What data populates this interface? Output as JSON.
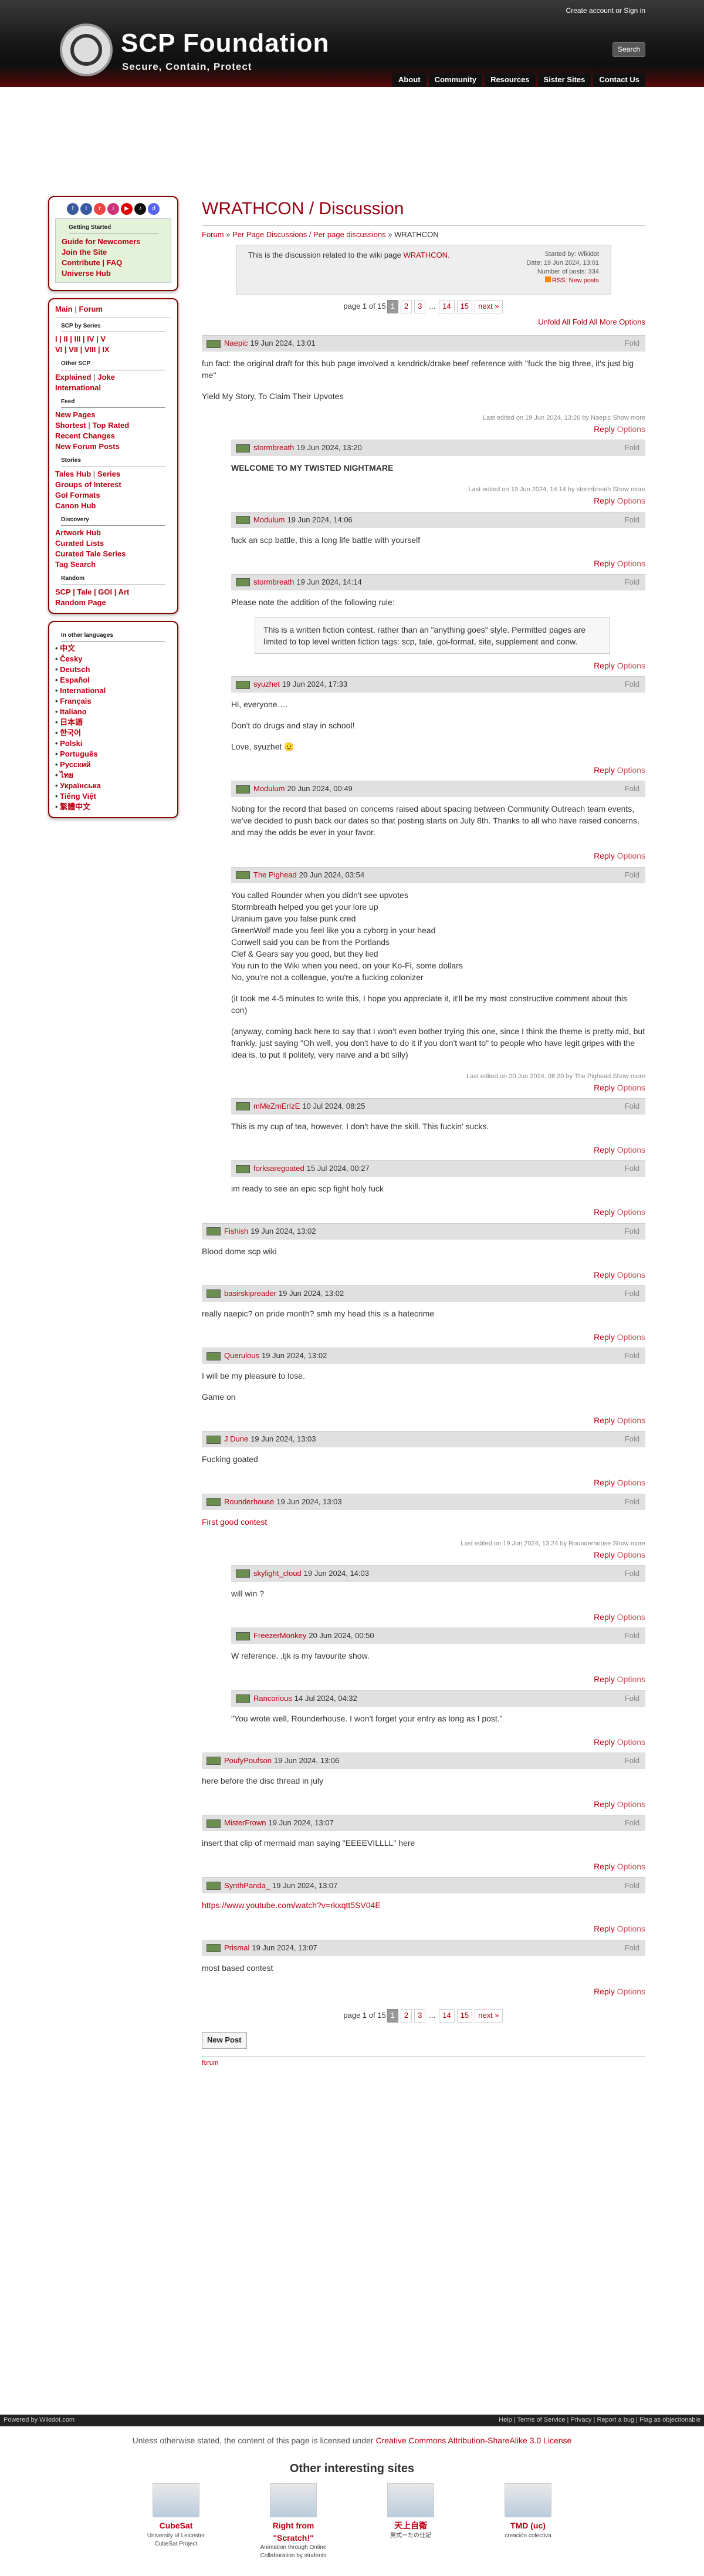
{
  "header": {
    "login_create": "Create account",
    "login_or": "or",
    "login_signin": "Sign in",
    "site_name": "SCP Foundation",
    "tagline": "Secure, Contain, Protect",
    "search": "Search",
    "topnav": [
      "About",
      "Community",
      "Resources",
      "Sister Sites",
      "Contact Us"
    ]
  },
  "sidebar": {
    "getting_started_title": "Getting Started",
    "getting_started": [
      "Guide for Newcomers",
      "Join the Site",
      "Contribute | FAQ",
      "Universe Hub"
    ],
    "main": "Main",
    "forum": "Forum",
    "scp_series_title": "SCP by Series",
    "series_row1": "I | II | III | IV | V",
    "series_row2": "VI | VII | VIII | IX",
    "other_scp_title": "Other SCP",
    "explained": "Explained",
    "joke": "Joke",
    "international": "International",
    "feed_title": "Feed",
    "new_pages": "New Pages",
    "shortest": "Shortest",
    "top_rated": "Top Rated",
    "recent_changes": "Recent Changes",
    "new_forum_posts": "New Forum Posts",
    "stories_title": "Stories",
    "tales_hub": "Tales Hub",
    "series": "Series",
    "groups": "Groups of Interest",
    "goi_formats": "GoI Formats",
    "canon_hub": "Canon Hub",
    "discovery_title": "Discovery",
    "artwork_hub": "Artwork Hub",
    "curated_lists": "Curated Lists",
    "curated_tale": "Curated Tale Series",
    "tag_search": "Tag Search",
    "random_title": "Random",
    "random_row": "SCP | Tale | GOI | Art",
    "random_page": "Random Page",
    "languages_title": "In other languages",
    "languages": [
      "中文",
      "Česky",
      "Deutsch",
      "Español",
      "International",
      "Français",
      "Italiano",
      "日本語",
      "한국어",
      "Polski",
      "Português",
      "Русский",
      "ไทย",
      "Українська",
      "Tiếng Việt",
      "繁體中文"
    ]
  },
  "main": {
    "title": "WRATHCON / Discussion",
    "breadcrumb": [
      "Forum",
      "Per Page Discussions / Per page discussions",
      "WRATHCON"
    ],
    "desc_text": "This is the discussion related to the wiki page",
    "desc_link": "WRATHCON.",
    "started_by": "Started by: Wikidot",
    "date": "Date: 19 Jun 2024, 13:01",
    "num_posts": "Number of posts: 334",
    "rss": "RSS: New posts",
    "pager": {
      "label": "page 1 of 15",
      "pages": [
        "1",
        "2",
        "3",
        "...",
        "14",
        "15",
        "next »"
      ]
    },
    "options": "Unfold All Fold All More Options",
    "reply": "Reply",
    "opts": "Options",
    "fold": "Fold",
    "new_post": "New Post",
    "forum_link": "forum"
  },
  "posts": [
    {
      "author": "Naepic",
      "date": "19 Jun 2024, 13:01",
      "body": [
        "fun fact: the original draft for this hub page involved a kendrick/drake beef reference with \"fuck the big three, it's just big me\"",
        "Yield My Story, To Claim Their Upvotes"
      ],
      "edited": "Last edited on 19 Jun 2024, 13:26 by Naepic Show more"
    },
    {
      "author": "stormbreath",
      "date": "19 Jun 2024, 13:20",
      "body": [
        "WELCOME TO MY TWISTED NIGHTMARE"
      ],
      "edited": "Last edited on 19 Jun 2024, 14:14 by stormbreath Show more"
    },
    {
      "author": "Modulum",
      "date": "19 Jun 2024, 14:06",
      "body": [
        "fuck an scp battle, this a long life battle with yourself"
      ]
    },
    {
      "author": "stormbreath",
      "date": "19 Jun 2024, 14:14",
      "body": [
        "Please note the addition of the following rule:"
      ],
      "quote": "This is a written fiction contest, rather than an \"anything goes\" style. Permitted pages are limited to top level written fiction tags: scp, tale, goi-format, site, supplement and conw."
    },
    {
      "author": "syuzhet",
      "date": "19 Jun 2024, 17:33",
      "body": [
        "Hi, everyone….",
        "Don't do drugs and stay in school!",
        "Love, syuzhet 🫡"
      ]
    },
    {
      "author": "Modulum",
      "date": "20 Jun 2024, 00:49",
      "body": [
        "Noting for the record that based on concerns raised about spacing between Community Outreach team events, we've decided to push back our dates so that posting starts on July 8th. Thanks to all who have raised concerns, and may the odds be ever in your favor."
      ]
    },
    {
      "author": "The Pighead",
      "date": "20 Jun 2024, 03:54",
      "lines": [
        "You called Rounder when you didn't see upvotes",
        "Stormbreath helped you get your lore up",
        "Uranium gave you false punk cred",
        "GreenWolf made you feel like you a cyborg in your head",
        "Conwell said you can be from the Portlands",
        "Clef & Gears say you good, but they lied",
        "You run to the Wiki when you need, on your Ko-Fi, some dollars",
        "No, you're not a colleague, you're a fucking colonizer"
      ],
      "body": [
        "(it took me 4-5 minutes to write this, I hope you appreciate it, it'll be my most constructive comment about this con)",
        "(anyway, coming back here to say that I won't even bother trying this one, since I think the theme is pretty mid, but frankly, just saying \"Oh well, you don't have to do it if you don't want to\" to people who have legit gripes with the idea is, to put it politely, very naive and a bit silly)"
      ],
      "edited": "Last edited on 20 Jun 2024, 06:20 by The Pighead Show more"
    },
    {
      "author": "mMeZmErIzE",
      "date": "10 Jul 2024, 08:25",
      "body": [
        "This is my cup of tea, however, I don't have the skill. This fuckin' sucks."
      ]
    },
    {
      "author": "forksaregoated",
      "date": "15 Jul 2024, 00:27",
      "body": [
        "im ready to see an epic scp fight holy fuck"
      ]
    },
    {
      "author": "Fishish",
      "date": "19 Jun 2024, 13:02",
      "body": [
        "Blood dome scp wiki"
      ]
    },
    {
      "author": "basirskipreader",
      "date": "19 Jun 2024, 13:02",
      "body": [
        "really naepic? on pride month? smh my head this is a hatecrime"
      ]
    },
    {
      "author": "Querulous",
      "date": "19 Jun 2024, 13:02",
      "body": [
        "I will be my pleasure to lose.",
        "Game on"
      ]
    },
    {
      "author": "J Dune",
      "date": "19 Jun 2024, 13:03",
      "body": [
        "Fucking goated"
      ]
    },
    {
      "author": "Rounderhouse",
      "date": "19 Jun 2024, 13:03",
      "link": "First good contest",
      "edited": "Last edited on 19 Jun 2024, 13:24 by Rounderhouse Show more"
    },
    {
      "author": "skylight_cloud",
      "date": "19 Jun 2024, 14:03",
      "body": [
        "will win ?"
      ]
    },
    {
      "author": "FreezerMonkey",
      "date": "20 Jun 2024, 00:50",
      "body": [
        "W reference. .tjk is my favourite show."
      ]
    },
    {
      "author": "Rancorious",
      "date": "14 Jul 2024, 04:32",
      "body": [
        "\"You wrote well, Rounderhouse. I won't forget your entry as long as I post.\""
      ]
    },
    {
      "author": "PoufyPoufson",
      "date": "19 Jun 2024, 13:06",
      "body": [
        "here before the disc thread in july"
      ]
    },
    {
      "author": "MisterFrown",
      "date": "19 Jun 2024, 13:07",
      "body": [
        "insert that clip of mermaid man saying \"EEEEVILLLL\" here"
      ]
    },
    {
      "author": "SynthPanda_",
      "date": "19 Jun 2024, 13:07",
      "link": "https://www.youtube.com/watch?v=rkxqtt5SV04E"
    },
    {
      "author": "Prismal",
      "date": "19 Jun 2024, 13:07",
      "body": [
        "most based contest"
      ]
    }
  ],
  "footer": {
    "powered": "Powered by Wikidot.com",
    "links": "Help | Terms of Service | Privacy | Report a bug | Flag as objectionable",
    "license_pre": "Unless otherwise stated, the content of this page is licensed under",
    "license_link": "Creative Commons Attribution-ShareAlike 3.0 License",
    "other_sites": "Other interesting sites",
    "sites": [
      {
        "name": "CubeSat",
        "desc": "University of Leicester CubeSat Project"
      },
      {
        "name": "Right from \"Scratch!\"",
        "desc": "Animation through Online Collaboration by students"
      },
      {
        "name": "天上自衛",
        "desc": "翼式ーたの仕記"
      },
      {
        "name": "TMD (uc)",
        "desc": "creación colectiva"
      }
    ]
  },
  "colors": {
    "accent": "#bb0011",
    "header_dark": "#141414",
    "sidebar_border": "#8b0000"
  }
}
